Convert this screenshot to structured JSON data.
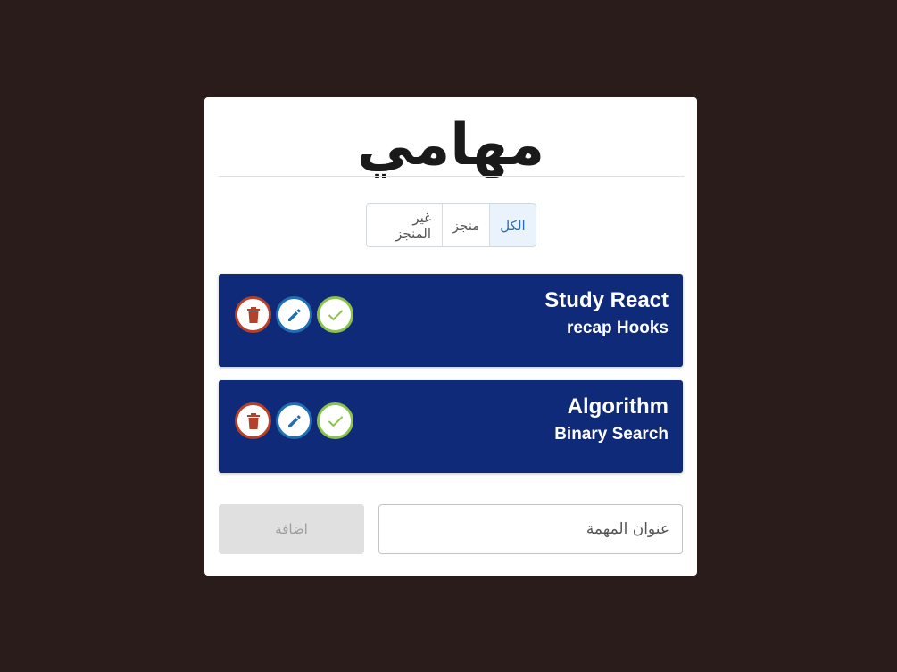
{
  "page": {
    "title": "مهامي"
  },
  "filters": {
    "all": "الكل",
    "done": "منجز",
    "not_done": "غير المنجز",
    "active": "all"
  },
  "todos": [
    {
      "title": "Study React",
      "details": "recap Hooks"
    },
    {
      "title": "Algorithm",
      "details": "Binary Search"
    }
  ],
  "form": {
    "input_placeholder": "عنوان المهمة",
    "input_value": "",
    "add_label": "اضافة"
  },
  "icons": {
    "delete": "trash-icon",
    "edit": "pencil-icon",
    "done": "check-icon"
  },
  "colors": {
    "background": "#2b1c1c",
    "card": "#ffffff",
    "todo_bg": "#0e2a78",
    "delete": "#b5412a",
    "edit": "#1f6fb2",
    "done": "#8bc34a",
    "active_filter_bg": "#eaf3fc",
    "active_filter_text": "#2a6fb5"
  }
}
